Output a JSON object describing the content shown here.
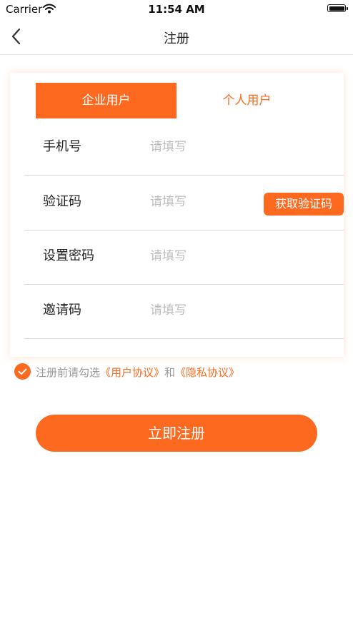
{
  "status_bar": {
    "carrier": "Carrier",
    "time": "11:54 AM"
  },
  "nav": {
    "title": "注册"
  },
  "tabs": [
    {
      "label": "企业用户",
      "active": true
    },
    {
      "label": "个人用户",
      "active": false
    }
  ],
  "form": {
    "rows": [
      {
        "label": "手机号",
        "placeholder": "请填写"
      },
      {
        "label": "验证码",
        "placeholder": "请填写"
      },
      {
        "label": "设置密码",
        "placeholder": "请填写"
      },
      {
        "label": "邀请码",
        "placeholder": "请填写"
      }
    ],
    "get_code_label": "获取验证码"
  },
  "agreement": {
    "checked": true,
    "prefix": "注册前请勾选",
    "user_agreement": "《用户协议》",
    "and": "和",
    "privacy_agreement": "《隐私协议》"
  },
  "submit_label": "立即注册",
  "colors": {
    "accent": "#fd6a1f",
    "placeholder": "#bdbdbd",
    "divider": "#d9d9d9"
  }
}
